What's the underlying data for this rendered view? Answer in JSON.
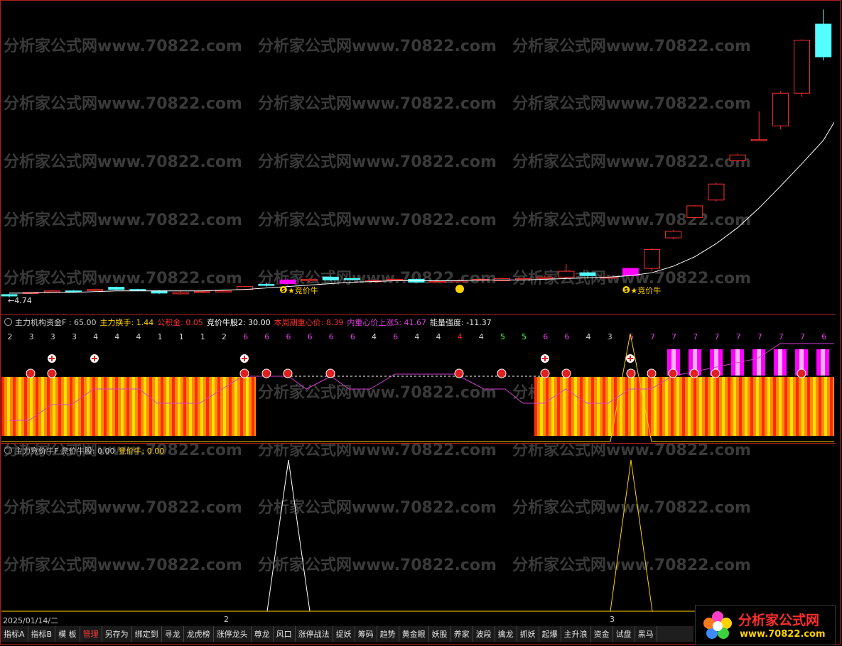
{
  "watermark": "分析家公式网www.70822.com",
  "main_chart": {
    "low_label": "←4.74",
    "signal_label": "★竞价牛",
    "signal_marker": "$"
  },
  "indicator1": {
    "name": "主力机构资金F",
    "fields": [
      {
        "label": "主力机构资金F : ",
        "value": "65.00",
        "color": "#d0d0d0"
      },
      {
        "label": "主力换手: ",
        "value": "1.44",
        "color": "#ffd200"
      },
      {
        "label": "公积金: ",
        "value": "0.05",
        "color": "#ff3030"
      },
      {
        "label": "竞价牛股2: ",
        "value": "30.00",
        "color": "#ffffff"
      },
      {
        "label": "本周期重心价: ",
        "value": "8.39",
        "color": "#ff3030"
      },
      {
        "label": "内重心价上涨5: ",
        "value": "41.67",
        "color": "#e040e0"
      },
      {
        "label": "能量强度: ",
        "value": "-11.37",
        "color": "#e6e6e6"
      }
    ],
    "digits": [
      "2",
      "3",
      "3",
      "3",
      "4",
      "4",
      "4",
      "1",
      "1",
      "1",
      "2",
      "6",
      "6",
      "6",
      "6",
      "6",
      "6",
      "4",
      "6",
      "4",
      "4",
      "4",
      "4",
      "5",
      "5",
      "6",
      "6",
      "4",
      "3",
      "6",
      "7",
      "7",
      "7",
      "7",
      "7",
      "7",
      "7",
      "7",
      "6"
    ],
    "digit_colors": {
      "1": "#d0d0d0",
      "2": "#d0d0d0",
      "3": "#d0d0d0",
      "4": "#d0d0d0",
      "5": "#40ff40",
      "6": "#e040e0",
      "7": "#e040e0",
      "red": "#ff2020"
    }
  },
  "indicator2": {
    "fields": [
      {
        "label": "主力竞价牛F  竞价牛股: ",
        "value": "0.00",
        "color": "#d0d0d0"
      },
      {
        "label": "竞价牛: ",
        "value": "0.00",
        "color": "#ffd200"
      }
    ]
  },
  "date_bar": {
    "date": "2025/01/14/二",
    "mark1": "2",
    "mark2": "3"
  },
  "tabs": [
    {
      "label": "指标A",
      "active": false
    },
    {
      "label": "指标B",
      "active": false
    },
    {
      "label": "模 板",
      "active": false
    },
    {
      "label": "管理",
      "active": true
    },
    {
      "label": "另存为",
      "active": false
    },
    {
      "label": "绑定到",
      "active": false
    },
    {
      "label": "寻龙",
      "active": false
    },
    {
      "label": "龙虎榜",
      "active": false
    },
    {
      "label": "涨停龙头",
      "active": false
    },
    {
      "label": "尊龙",
      "active": false
    },
    {
      "label": "风口",
      "active": false
    },
    {
      "label": "涨停战法",
      "active": false
    },
    {
      "label": "捉妖",
      "active": false
    },
    {
      "label": "筹码",
      "active": false
    },
    {
      "label": "趋势",
      "active": false
    },
    {
      "label": "黄金眼",
      "active": false
    },
    {
      "label": "妖股",
      "active": false
    },
    {
      "label": "养家",
      "active": false
    },
    {
      "label": "波段",
      "active": false
    },
    {
      "label": "擒龙",
      "active": false
    },
    {
      "label": "抓妖",
      "active": false
    },
    {
      "label": "起爆",
      "active": false
    },
    {
      "label": "主升浪",
      "active": false
    },
    {
      "label": "资金",
      "active": false
    },
    {
      "label": "试盘",
      "active": false
    },
    {
      "label": "黑马",
      "active": false
    }
  ],
  "logo": {
    "title": "分析家公式网",
    "url": "www.70822.com"
  },
  "colors": {
    "up": "#ff3030",
    "down": "#54ffff",
    "signal": "#ff00ff",
    "ma": "#ffffff",
    "frame": "#b21e1e"
  }
}
